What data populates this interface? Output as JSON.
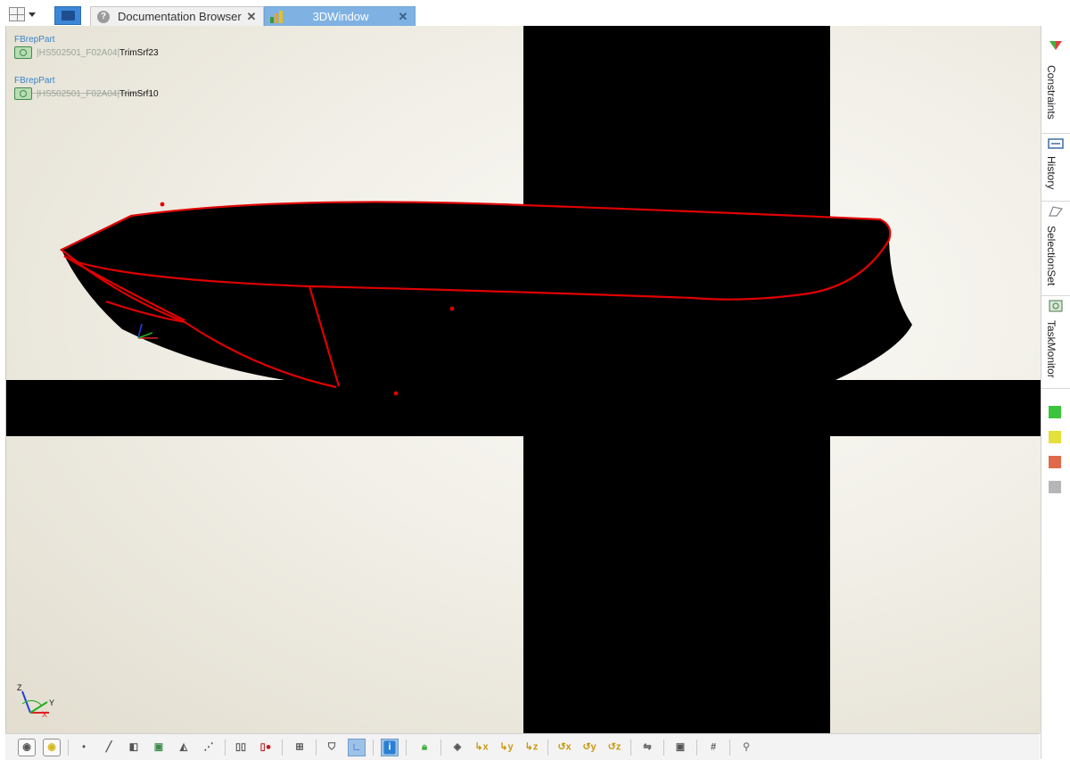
{
  "tabs": {
    "documentation": "Documentation Browser",
    "window3d": "3DWindow",
    "close_glyph": "✕"
  },
  "viewport": {
    "selections": [
      {
        "class_name": "FBrepPart",
        "path": "|HS502501_F02A04|",
        "name": "TrimSrf23"
      },
      {
        "class_name": "FBrepPart",
        "path": "|HS502501_F02A04|",
        "name": "TrimSrf10"
      }
    ],
    "axes": {
      "z": "Z",
      "y": "Y",
      "x": "X"
    }
  },
  "right_dock": {
    "tabs": [
      "Constraints",
      "History",
      "SelectionSet",
      "TaskMonitor"
    ],
    "status_colors": [
      "#3cc43c",
      "#e4e03c",
      "#e0694a",
      "#b6b6b6"
    ]
  },
  "toolbar": {
    "buttons": [
      "radio-off",
      "radio-on",
      "point",
      "curve",
      "surface",
      "part",
      "solid",
      "dotted-line",
      "wireframe",
      "remove-hidden",
      "section",
      "shield",
      "axis",
      "info",
      "lock",
      "cube",
      "view-x",
      "view-y",
      "view-z",
      "rotate-neg-x",
      "rotate-neg-y",
      "rotate-neg-z",
      "flip",
      "camera",
      "grid",
      "zoom"
    ]
  },
  "colors": {
    "accent_tab": "#7fb2e3",
    "highlight": "#e00000",
    "shape": "#000000"
  }
}
